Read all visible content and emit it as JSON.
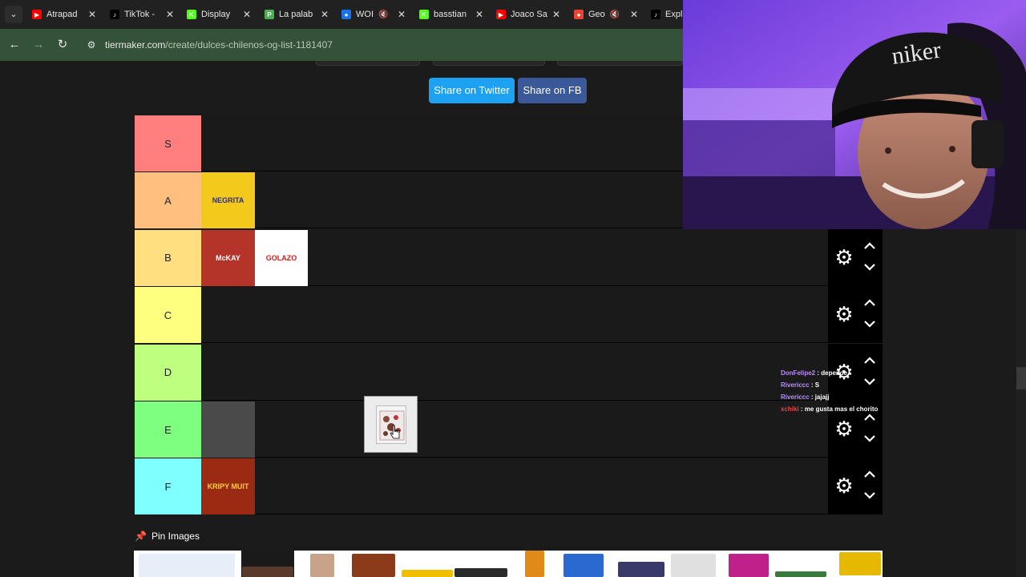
{
  "browser": {
    "tabs": [
      {
        "title": "Atrapad",
        "favicon": "youtube-icon",
        "color": "#ff0000",
        "glyph": "▶",
        "muted": false
      },
      {
        "title": "TikTok -",
        "favicon": "tiktok-icon",
        "color": "#000000",
        "glyph": "♪",
        "muted": false
      },
      {
        "title": "Display",
        "favicon": "kick-icon",
        "color": "#53fc18",
        "glyph": "K",
        "muted": false
      },
      {
        "title": "La palab",
        "favicon": "p-icon",
        "color": "#4caf50",
        "glyph": "P",
        "muted": false
      },
      {
        "title": "WOI",
        "favicon": "globe-icon",
        "color": "#1a73e8",
        "glyph": "●",
        "muted": true
      },
      {
        "title": "basstian",
        "favicon": "kick-icon",
        "color": "#53fc18",
        "glyph": "K",
        "muted": false
      },
      {
        "title": "Joaco Sa",
        "favicon": "youtube-icon",
        "color": "#ff0000",
        "glyph": "▶",
        "muted": false
      },
      {
        "title": "Geo",
        "favicon": "map-pin-icon",
        "color": "#ea4335",
        "glyph": "●",
        "muted": true
      },
      {
        "title": "Expl",
        "favicon": "tiktok-icon",
        "color": "#000000",
        "glyph": "♪",
        "muted": false
      }
    ],
    "url_domain": "tiermaker.com",
    "url_path": "/create/dulces-chilenos-og-list-1181407"
  },
  "share": {
    "twitter_label": "Share on Twitter",
    "fb_label": "Share on FB"
  },
  "tiers": [
    {
      "label": "S",
      "color": "#ff7f7f",
      "items": []
    },
    {
      "label": "A",
      "color": "#ffbf7f",
      "items": [
        {
          "name": "NEGRITA",
          "bg": "#f3c91b",
          "fg": "#2b2b8a"
        }
      ]
    },
    {
      "label": "B",
      "color": "#ffdf7f",
      "items": [
        {
          "name": "McKAY",
          "bg": "#b4342a",
          "fg": "#ffffff"
        },
        {
          "name": "GOLAZO",
          "bg": "#ffffff",
          "fg": "#d11a1a"
        }
      ]
    },
    {
      "label": "C",
      "color": "#ffff7f",
      "items": []
    },
    {
      "label": "D",
      "color": "#bfff7f",
      "items": []
    },
    {
      "label": "E",
      "color": "#7fff7f",
      "items": [
        {
          "name": "",
          "bg": "#4a4a4a",
          "fg": "#999999"
        }
      ]
    },
    {
      "label": "F",
      "color": "#7fffff",
      "items": [
        {
          "name": "KRIPY MUIT",
          "bg": "#9a2a12",
          "fg": "#ffd23a"
        }
      ]
    }
  ],
  "pin": {
    "label": "Pin Images"
  },
  "chat": [
    {
      "user": "DonFelipe2",
      "user_color": "#b98cff",
      "message": "depende"
    },
    {
      "user": "Rivericcc",
      "user_color": "#b98cff",
      "message": "S"
    },
    {
      "user": "Rivericcc",
      "user_color": "#b98cff",
      "message": "jajajj"
    },
    {
      "user": "xchiki",
      "user_color": "#ff3b3b",
      "message": "me gusta mas el chorito"
    }
  ]
}
